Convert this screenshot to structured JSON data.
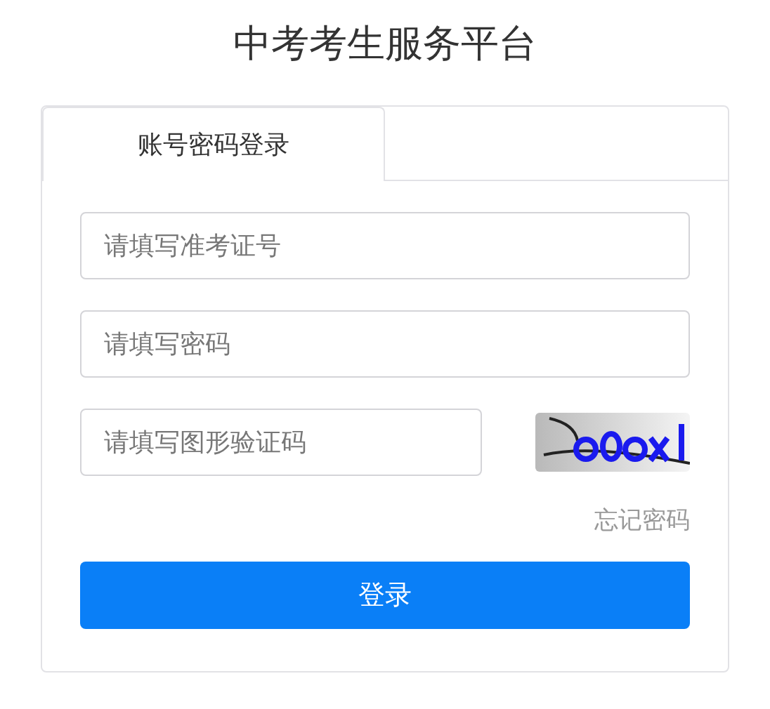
{
  "title": "中考考生服务平台",
  "tabs": [
    {
      "label": "账号密码登录",
      "selected": true
    }
  ],
  "fields": [
    {
      "kind": "text",
      "placeholder": "请填写准考证号"
    },
    {
      "kind": "password",
      "placeholder": "请填写密码"
    },
    {
      "kind": "captcha",
      "placeholder": "请填写图形验证码"
    }
  ],
  "forgot_link": "忘记密码",
  "login_button": "登录"
}
